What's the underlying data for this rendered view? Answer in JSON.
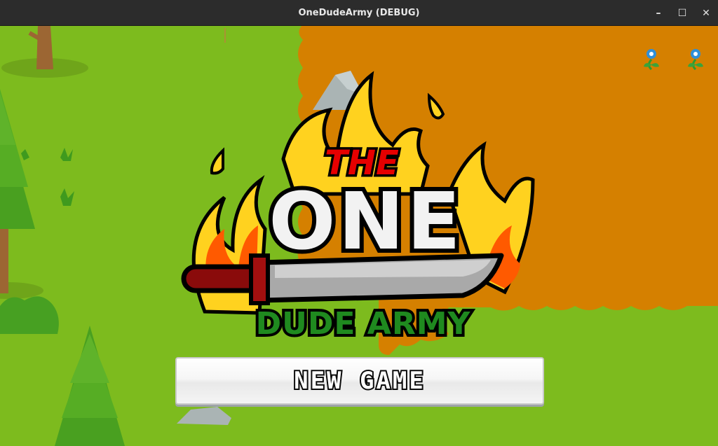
{
  "window": {
    "title": "OneDudeArmy (DEBUG)",
    "controls": {
      "minimize_icon": "minimize-icon",
      "maximize_icon": "maximize-icon",
      "close_icon": "close-icon",
      "minimize": "–",
      "maximize": "☐",
      "close": "✕"
    }
  },
  "logo": {
    "line1": "THE",
    "line2": "ONE",
    "line3": "DUDE ARMY"
  },
  "menu": {
    "new_game_label": "NEW GAME"
  },
  "colors": {
    "grass": "#7dbb1e",
    "dirt": "#d68000",
    "flame_outer": "#ffcc22",
    "flame_inner": "#ff5500",
    "logo_red": "#e60000",
    "logo_green": "#1f8a1f",
    "titlebar": "#2c2c2c"
  }
}
